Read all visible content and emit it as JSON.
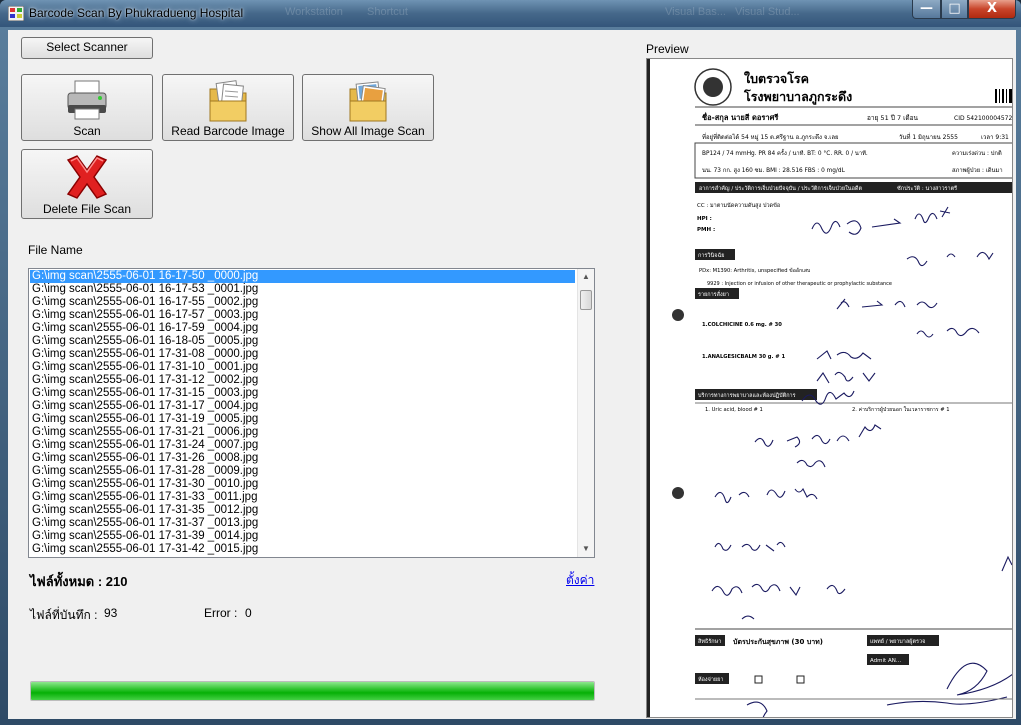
{
  "window": {
    "title": "Barcode Scan By Phukradueng Hospital",
    "ghost_items": [
      "Workstation",
      "Shortcut",
      "Visual Bas...",
      "Visual Stud..."
    ],
    "buttons": {
      "minimize": "—",
      "maximize": "□",
      "close": "X"
    }
  },
  "toolbar": {
    "select_scanner": "Select Scanner",
    "scan": "Scan",
    "read_barcode": "Read Barcode Image",
    "show_all": "Show All Image Scan",
    "delete": "Delete File Scan"
  },
  "file_list": {
    "label": "File Name",
    "selected_index": 0,
    "items": [
      "G:\\img scan\\2555-06-01 16-17-50 _0000.jpg",
      "G:\\img scan\\2555-06-01 16-17-53 _0001.jpg",
      "G:\\img scan\\2555-06-01 16-17-55 _0002.jpg",
      "G:\\img scan\\2555-06-01 16-17-57 _0003.jpg",
      "G:\\img scan\\2555-06-01 16-17-59 _0004.jpg",
      "G:\\img scan\\2555-06-01 16-18-05 _0005.jpg",
      "G:\\img scan\\2555-06-01 17-31-08 _0000.jpg",
      "G:\\img scan\\2555-06-01 17-31-10 _0001.jpg",
      "G:\\img scan\\2555-06-01 17-31-12 _0002.jpg",
      "G:\\img scan\\2555-06-01 17-31-15 _0003.jpg",
      "G:\\img scan\\2555-06-01 17-31-17 _0004.jpg",
      "G:\\img scan\\2555-06-01 17-31-19 _0005.jpg",
      "G:\\img scan\\2555-06-01 17-31-21 _0006.jpg",
      "G:\\img scan\\2555-06-01 17-31-24 _0007.jpg",
      "G:\\img scan\\2555-06-01 17-31-26 _0008.jpg",
      "G:\\img scan\\2555-06-01 17-31-28 _0009.jpg",
      "G:\\img scan\\2555-06-01 17-31-30 _0010.jpg",
      "G:\\img scan\\2555-06-01 17-31-33 _0011.jpg",
      "G:\\img scan\\2555-06-01 17-31-35 _0012.jpg",
      "G:\\img scan\\2555-06-01 17-31-37 _0013.jpg",
      "G:\\img scan\\2555-06-01 17-31-39 _0014.jpg",
      "G:\\img scan\\2555-06-01 17-31-42 _0015.jpg"
    ]
  },
  "stats": {
    "total_label": "ไฟล์ทั้งหมด : 210",
    "settings_link": "ตั้งค่า",
    "saved_label": "ไฟล์ที่บันทึก :",
    "saved_value": "93",
    "error_label": "Error :",
    "error_value": "0"
  },
  "progress": {
    "fraction": 1.0
  },
  "preview": {
    "label": "Preview",
    "doc_title_1": "ใบตรวจโรค",
    "doc_title_2": "โรงพยาบาลภูกระดึง",
    "name_line": "ชื่อ-สกุล  นายสี  ดอราศรี",
    "age_line": "อายุ  51  ปี  7  เดือน",
    "cid": "CID  542100004572",
    "address": "ที่อยู่ที่ติดต่อได้  54 หมู่ 15 ต.ศรีฐาน  อ.ภูกระดึง จ.เลย",
    "date": "วันที่ 1 มิถุนายน 2555",
    "time": "เวลา 9:31",
    "vitals_1": "BP124 / 74 mmHg.  PR  84  ครั้ง / นาที.  BT:  0  °C.  RR.  0  / นาที.",
    "urgency": "ความเร่งด่วน : ปกติ",
    "vitals_2": "นน.  73  กก.  สูง  160  ซม.   BMI : 28.516  FBS :  0  mg/dL",
    "patient_status": "สภาพผู้ป่วย : เดินมา",
    "history_bar": "อาการสำคัญ / ประวัติการเจ็บป่วยปัจจุบัน / ประวัติการเจ็บป่วยในอดีต",
    "history_right": "ซักประวัติ : นางสาวราตรี",
    "cc": "CC : มาตามนัดความดันสูง ปวดข้อ",
    "hpi": "HPI :",
    "pmh": "PMH :",
    "diag_bar": "การวินิจฉัย",
    "pdx": "PDx: M1390: Arthritis, unspecified  ข้ออักเสบ",
    "proc": "9929 : Injection or infusion of other therapeutic or prophylactic substance",
    "rx_bar": "รายการสั่งยา",
    "rx1": "1.COLCHICINE  0.6 mg. # 30",
    "rx2": "1.ANALGESICBALM  30 g. # 1",
    "svc_bar": "บริการทางการพยาบาลและห้องปฏิบัติการ",
    "svc1": "1.  Uric acid, blood  # 1",
    "svc2": "2.  ค่าบริการผู้ป่วยนอก ในเวลาราชการ  # 1",
    "rights_bar": "สิทธิรักษา",
    "rights": "บัตรประกันสุขภาพ (30 บาท)",
    "doctor_bar": "แพทย์ / พยาบาลผู้ตรวจ",
    "admit": "Admit AN...",
    "room_bar": "ห้องจ่ายยา"
  }
}
